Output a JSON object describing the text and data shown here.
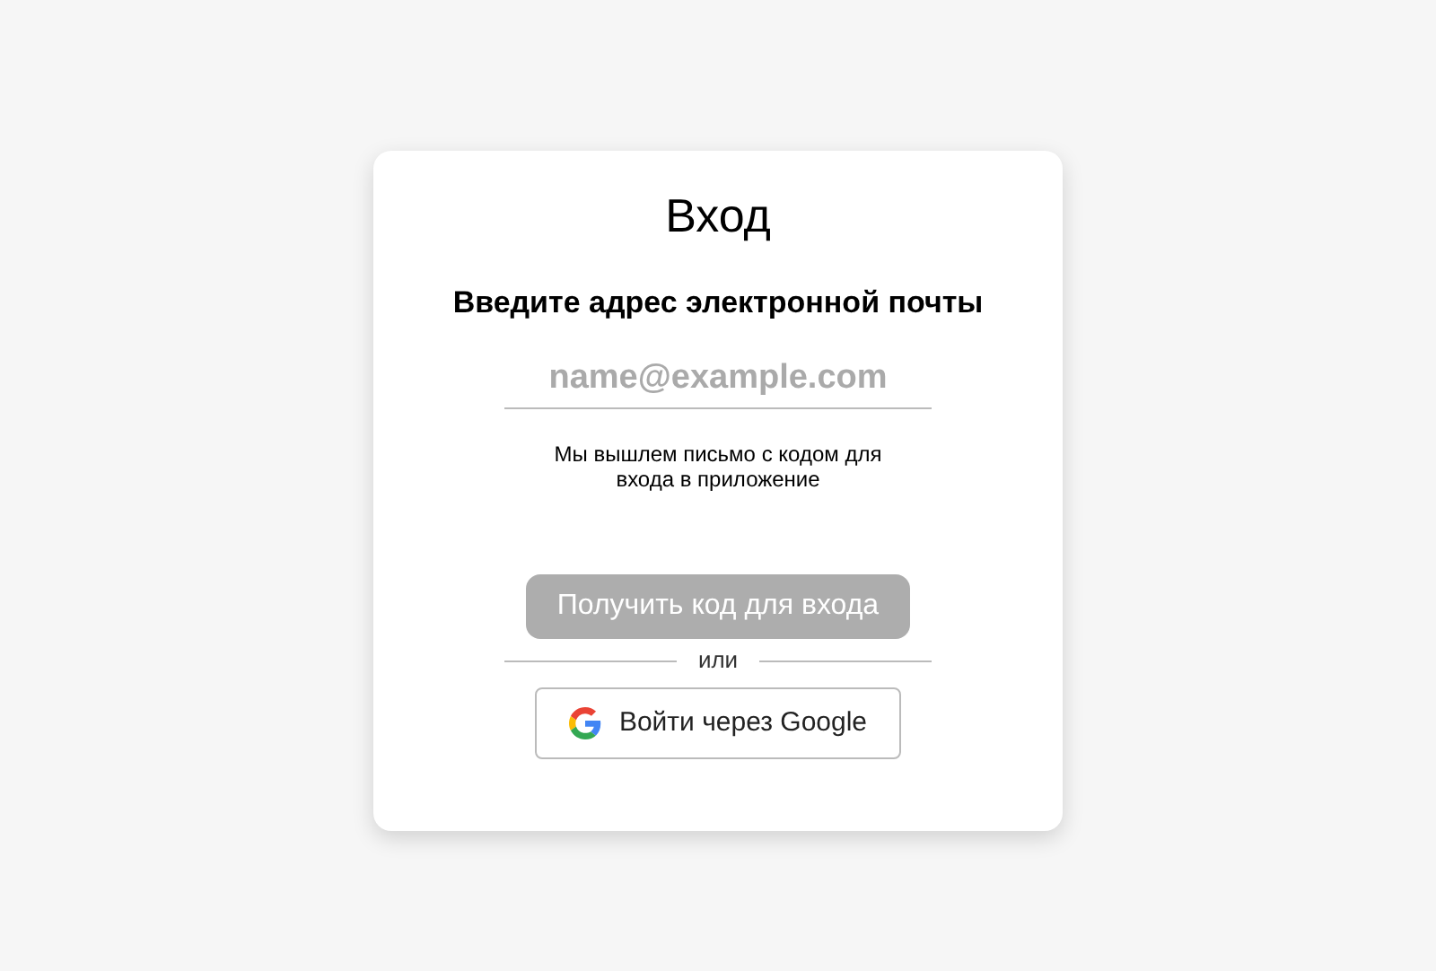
{
  "title": "Вход",
  "heading": "Введите адрес электронной почты",
  "email_field": {
    "placeholder": "name@example.com"
  },
  "note": "Мы вышлем письмо с кодом для входа в приложение",
  "submit_button": {
    "label": "Получить код для входа",
    "disabled": true
  },
  "divider_text": "или",
  "google_button": {
    "label": "Войти через Google"
  }
}
